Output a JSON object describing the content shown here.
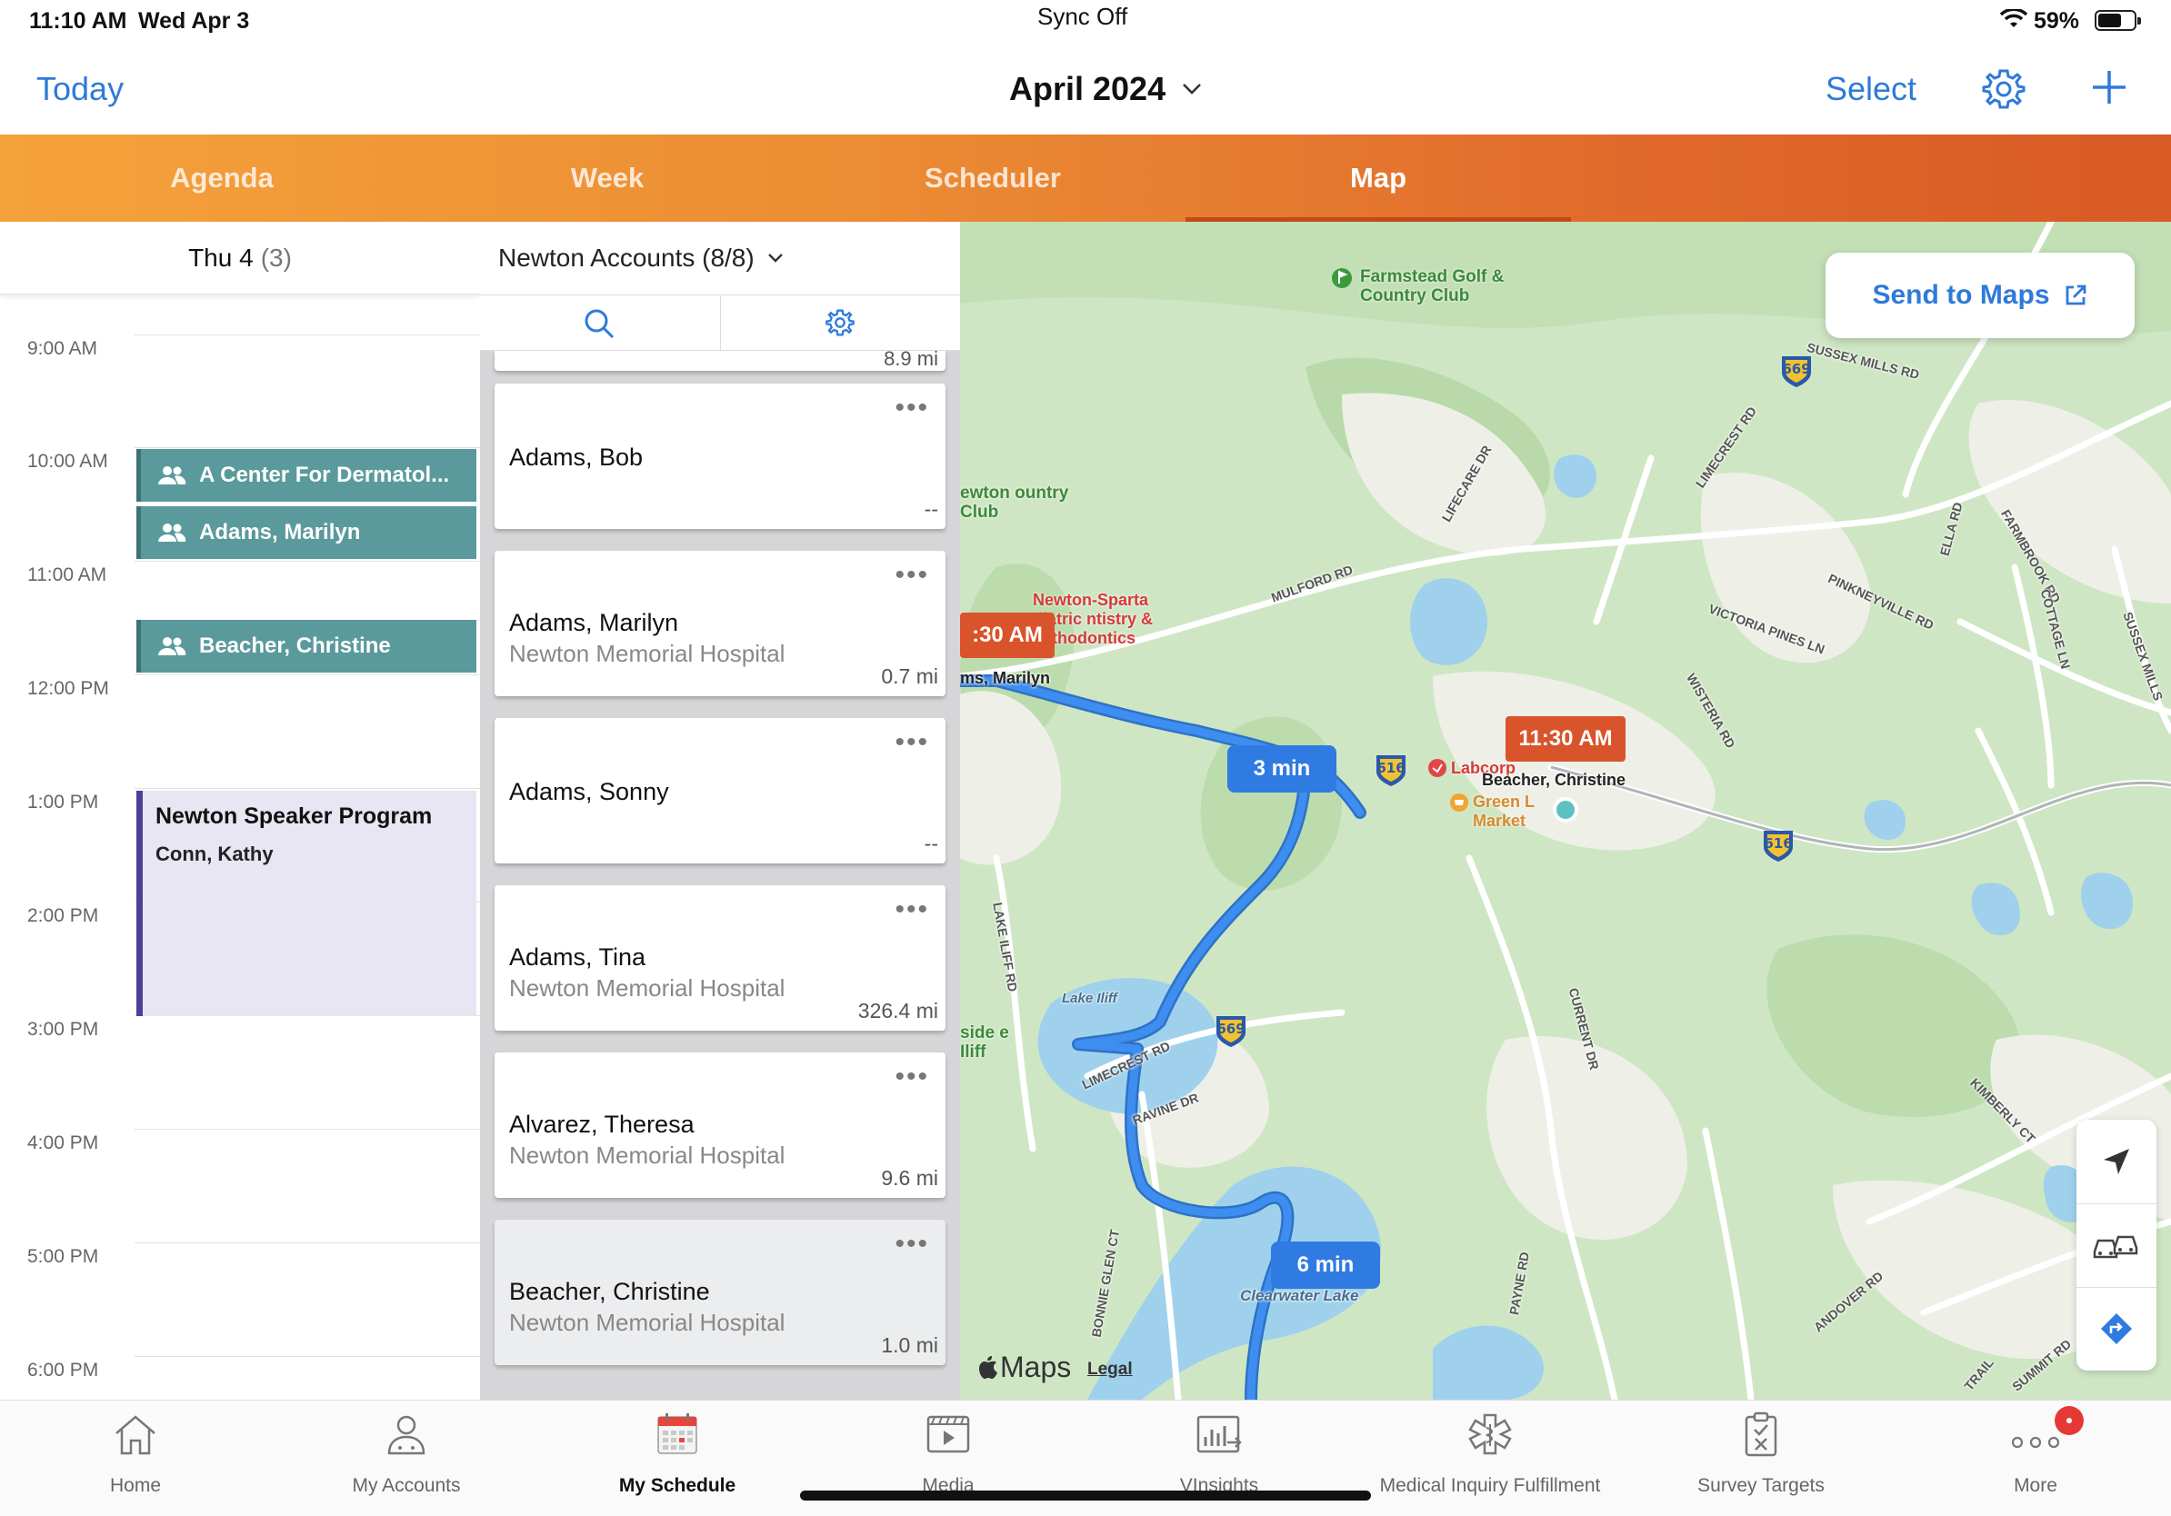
{
  "status_bar": {
    "time": "11:10 AM",
    "date": "Wed Apr 3",
    "sync": "Sync Off",
    "battery": "59%"
  },
  "nav": {
    "today": "Today",
    "title": "April 2024",
    "select": "Select"
  },
  "tabs": [
    {
      "label": "Agenda",
      "active": false
    },
    {
      "label": "Week",
      "active": false
    },
    {
      "label": "Scheduler",
      "active": false
    },
    {
      "label": "Map",
      "active": true
    }
  ],
  "day": {
    "label": "Thu 4",
    "count": "(3)",
    "hours": [
      "9:00 AM",
      "10:00 AM",
      "11:00 AM",
      "12:00 PM",
      "1:00 PM",
      "2:00 PM",
      "3:00 PM",
      "4:00 PM",
      "5:00 PM",
      "6:00 PM"
    ],
    "events": [
      {
        "title": "A Center For Dermatol..."
      },
      {
        "title": "Adams, Marilyn"
      },
      {
        "title": "Beacher, Christine"
      }
    ],
    "program": {
      "title": "Newton Speaker Program",
      "subtitle": "Conn, Kathy"
    }
  },
  "accounts": {
    "header": "Newton Accounts (8/8)",
    "top_partial_distance": "8.9 mi",
    "cards": [
      {
        "name": "Adams, Bob",
        "org": "",
        "distance": "--"
      },
      {
        "name": "Adams, Marilyn",
        "org": "Newton Memorial Hospital",
        "distance": "0.7 mi"
      },
      {
        "name": "Adams, Sonny",
        "org": "",
        "distance": "--"
      },
      {
        "name": "Adams, Tina",
        "org": "Newton Memorial Hospital",
        "distance": "326.4 mi"
      },
      {
        "name": "Alvarez, Theresa",
        "org": "Newton Memorial Hospital",
        "distance": "9.6 mi"
      },
      {
        "name": "Beacher, Christine",
        "org": "Newton Memorial Hospital",
        "distance": "1.0 mi"
      }
    ]
  },
  "map": {
    "send_to_maps": "Send to Maps",
    "route_times": [
      "3 min",
      "6 min"
    ],
    "stops": [
      {
        "time": ":30 AM",
        "name": "ms, Marilyn"
      },
      {
        "time": "11:30 AM",
        "name": "Beacher, Christine"
      }
    ],
    "labels": {
      "golf": "Farmstead Golf & Country Club",
      "country_club": "ewton ountry Club",
      "podiatric": "Newton-Sparta diatric ntistry & Orthodontics",
      "labcorp": "Labcorp",
      "market": "Green L Market",
      "lake_iliff": "Lake Iliff",
      "side_iliff": "side e Iliff",
      "clearwater": "Clearwater Lake",
      "sussex_mills": "SUSSEX MILLS RD",
      "limecrest": "LIMECREST RD",
      "lifecare": "LIFECARE DR",
      "mulford": "MULFORD RD",
      "victoria": "VICTORIA PINES LN",
      "pinkneyville": "PINKNEYVILLE RD",
      "ella": "ELLA RD",
      "farmbrook": "FARMBROOK RD",
      "cottage": "COTTAGE LN",
      "wisteria": "WISTERIA RD",
      "lake_iliff_rd": "LAKE ILIFF RD",
      "current": "CURRENT DR",
      "ravine": "RAVINE DR",
      "limecrest2": "LIMECREST RD",
      "bonnie": "BONNIE GLEN CT",
      "payne": "PAYNE RD",
      "andover": "ANDOVER RD",
      "kimberly": "KIMBERLY CT",
      "summit": "SUMMIT RD",
      "trail": "TRAIL",
      "sussex_mills2": "SUSSEX MILLS"
    },
    "shields": [
      "669",
      "616",
      "616",
      "669"
    ],
    "brand": "Maps",
    "legal": "Legal"
  },
  "bottom_tabs": [
    {
      "label": "Home",
      "icon": "home-icon",
      "active": false
    },
    {
      "label": "My Accounts",
      "icon": "person-icon",
      "active": false
    },
    {
      "label": "My Schedule",
      "icon": "calendar-icon",
      "active": true
    },
    {
      "label": "Media",
      "icon": "media-icon",
      "active": false
    },
    {
      "label": "VInsights",
      "icon": "chart-icon",
      "active": false
    },
    {
      "label": "Medical Inquiry Fulfillment",
      "icon": "medical-icon",
      "active": false
    },
    {
      "label": "Survey Targets",
      "icon": "clipboard-icon",
      "active": false
    },
    {
      "label": "More",
      "icon": "more-icon",
      "active": false
    }
  ],
  "colors": {
    "accent": "#2f7ad9",
    "event": "#5b9a9c",
    "route": "#2f7be2",
    "badge": "#d9542a"
  }
}
